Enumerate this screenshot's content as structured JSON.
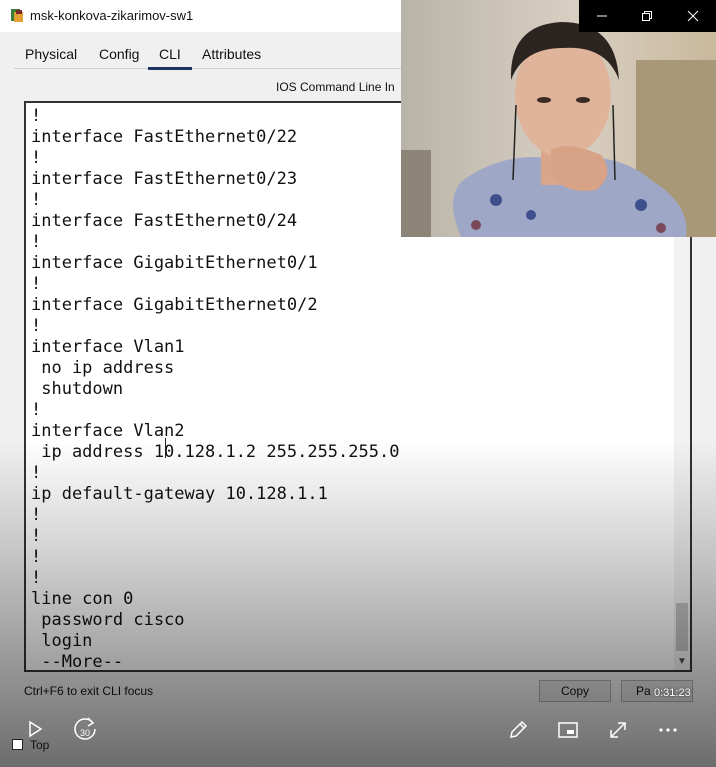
{
  "window": {
    "title": "msk-konkova-zikarimov-sw1",
    "controls": [
      "minimize-icon",
      "restore-icon",
      "close-icon"
    ]
  },
  "tabs": [
    {
      "label": "Physical",
      "active": false
    },
    {
      "label": "Config",
      "active": false
    },
    {
      "label": "CLI",
      "active": true
    },
    {
      "label": "Attributes",
      "active": false
    }
  ],
  "cli": {
    "heading": "IOS Command Line In",
    "lines": [
      "!",
      "interface FastEthernet0/22",
      "!",
      "interface FastEthernet0/23",
      "!",
      "interface FastEthernet0/24",
      "!",
      "interface GigabitEthernet0/1",
      "!",
      "interface GigabitEthernet0/2",
      "!",
      "interface Vlan1",
      " no ip address",
      " shutdown",
      "!",
      "interface Vlan2",
      " ip address 10.128.1.2 255.255.255.0",
      "!",
      "ip default-gateway 10.128.1.1",
      "!",
      "!",
      "!",
      "!",
      "line con 0",
      " password cisco",
      " login",
      " --More--"
    ],
    "hint": "Ctrl+F6 to exit CLI focus",
    "copy_label": "Copy",
    "paste_label": "Pa"
  },
  "player": {
    "time": "0:31:23",
    "skip_label": "30",
    "top_label": "Top",
    "top_checked": false
  },
  "colors": {
    "tab_underline": "#1a3561",
    "window_controls_bg": "#000000",
    "terminal_bg": "#ffffff"
  }
}
